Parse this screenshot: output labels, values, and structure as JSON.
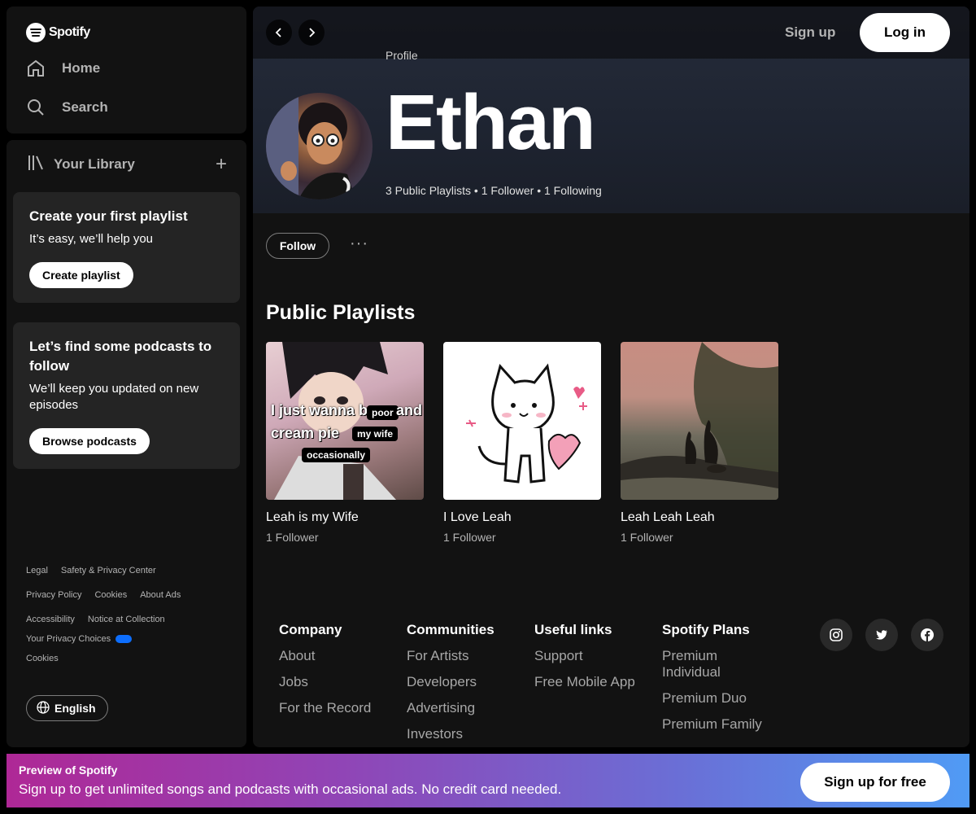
{
  "brand": {
    "name": "Spotify"
  },
  "nav": {
    "home": "Home",
    "search": "Search"
  },
  "library": {
    "title": "Your Library",
    "create_card": {
      "title": "Create your first playlist",
      "text": "It’s easy, we’ll help you",
      "button": "Create playlist"
    },
    "podcast_card": {
      "title": "Let’s find some podcasts to follow",
      "text": "We’ll keep you updated on new episodes",
      "button": "Browse podcasts"
    },
    "links": {
      "legal": "Legal",
      "safety": "Safety & Privacy Center",
      "privacy_policy": "Privacy Policy",
      "cookies": "Cookies",
      "about_ads": "About Ads",
      "accessibility": "Accessibility",
      "notice": "Notice at Collection",
      "privacy_choices": "Your Privacy Choices",
      "cookies2": "Cookies"
    },
    "language": "English"
  },
  "header": {
    "signup": "Sign up",
    "login": "Log in"
  },
  "profile": {
    "label": "Profile",
    "name": "Ethan",
    "stats": "3 Public Playlists • 1 Follower • 1 Following",
    "follow": "Follow",
    "more": "···"
  },
  "playlists": {
    "section_title": "Public Playlists",
    "items": [
      {
        "name": "Leah is my Wife",
        "sub": "1 Follower",
        "caption1": "I just wanna be",
        "tag1": "poor",
        "caption2": "and",
        "caption3": "cream pie",
        "tag2": "my wife",
        "tag3": "occasionally"
      },
      {
        "name": "I Love Leah",
        "sub": "1 Follower"
      },
      {
        "name": "Leah Leah Leah",
        "sub": "1 Follower"
      }
    ]
  },
  "footer": {
    "company": {
      "title": "Company",
      "links": [
        "About",
        "Jobs",
        "For the Record"
      ]
    },
    "communities": {
      "title": "Communities",
      "links": [
        "For Artists",
        "Developers",
        "Advertising",
        "Investors"
      ]
    },
    "useful": {
      "title": "Useful links",
      "links": [
        "Support",
        "Free Mobile App"
      ]
    },
    "plans": {
      "title": "Spotify Plans",
      "links": [
        "Premium Individual",
        "Premium Duo",
        "Premium Family"
      ]
    }
  },
  "preview": {
    "title": "Preview of Spotify",
    "text": "Sign up to get unlimited songs and podcasts with occasional ads. No credit card needed.",
    "button": "Sign up for free"
  },
  "colors": {
    "background": "#000000",
    "panel": "#121212",
    "card": "#242424",
    "muted": "#b3b3b3"
  }
}
